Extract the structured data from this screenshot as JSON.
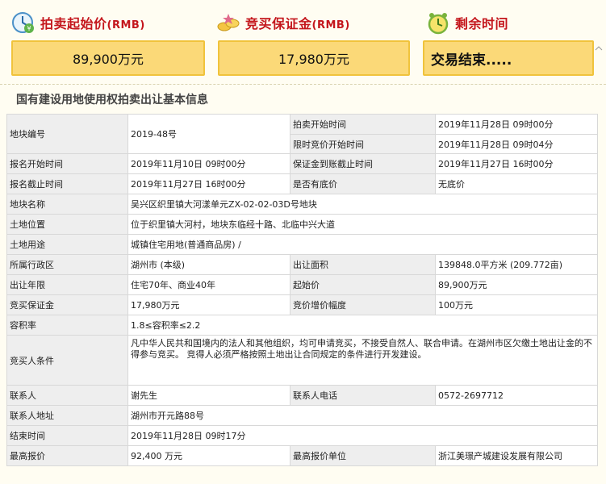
{
  "header": {
    "start_price_label": "拍卖起始价",
    "deposit_label": "竞买保证金",
    "remaining_label": "剩余时间",
    "rmb_suffix": "(RMB)",
    "start_price_value": "89,900万元",
    "deposit_value": "17,980万元",
    "remaining_value": "交易结束....."
  },
  "section_title": "国有建设用地使用权拍卖出让基本信息",
  "rows": {
    "plot_no_k": "地块编号",
    "plot_no_v": "2019-48号",
    "auction_start_k": "拍卖开始时间",
    "auction_start_v": "2019年11月28日 09时00分",
    "limit_start_k": "限时竞价开始时间",
    "limit_start_v": "2019年11月28日 09时04分",
    "reg_start_k": "报名开始时间",
    "reg_start_v": "2019年11月10日 09时00分",
    "deposit_deadline_k": "保证金到账截止时间",
    "deposit_deadline_v": "2019年11月27日 16时00分",
    "reg_end_k": "报名截止时间",
    "reg_end_v": "2019年11月27日 16时00分",
    "reserve_k": "是否有底价",
    "reserve_v": "无底价",
    "plot_name_k": "地块名称",
    "plot_name_v": "吴兴区织里镇大河漾单元ZX-02-02-03D号地块",
    "location_k": "土地位置",
    "location_v": "位于织里镇大河村，地块东临经十路、北临中兴大道",
    "usage_k": "土地用途",
    "usage_v": "城镇住宅用地(普通商品房) /",
    "district_k": "所属行政区",
    "district_v": "湖州市 (本级)",
    "area_k": "出让面积",
    "area_v": "139848.0平方米 (209.772亩)",
    "term_k": "出让年限",
    "term_v": "住宅70年、商业40年",
    "start_price_k": "起始价",
    "start_price_v": "89,900万元",
    "deposit_k": "竞买保证金",
    "deposit_v": "17,980万元",
    "increment_k": "竞价增价幅度",
    "increment_v": "100万元",
    "far_k": "容积率",
    "far_v": "1.8≤容积率≤2.2",
    "conditions_k": "竞买人条件",
    "conditions_v": "凡中华人民共和国境内的法人和其他组织，均可申请竞买，不接受自然人、联合申请。在湖州市区欠缴土地出让金的不得参与竞买。 竞得人必须严格按照土地出让合同规定的条件进行开发建设。",
    "contact_k": "联系人",
    "contact_v": "谢先生",
    "phone_k": "联系人电话",
    "phone_v": "0572-2697712",
    "address_k": "联系人地址",
    "address_v": "湖州市开元路88号",
    "end_time_k": "结束时间",
    "end_time_v": "2019年11月28日 09时17分",
    "top_bid_k": "最高报价",
    "top_bid_v": "92,400 万元",
    "top_bidder_k": "最高报价单位",
    "top_bidder_v": "浙江美璟产城建设发展有限公司"
  },
  "colors": {
    "accent_red": "#c4161c",
    "box_fill": "#fbd978",
    "box_border": "#f0c33c",
    "key_bg": "#eeeeee"
  }
}
